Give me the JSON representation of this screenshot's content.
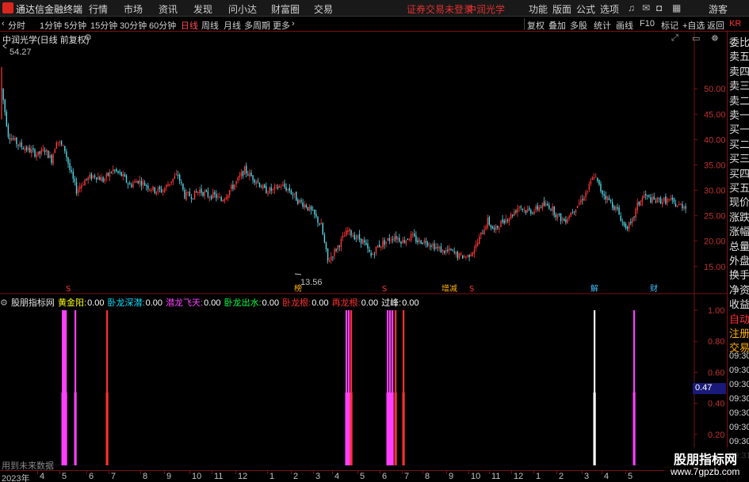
{
  "top_bar": {
    "app_name": "通达信金融终端",
    "menus": [
      "行情",
      "市场",
      "资讯",
      "发现",
      "问小达",
      "财富圈",
      "交易"
    ],
    "alert": "证券交易未登录",
    "alert_stock": "中润光学",
    "right_menus": [
      "功能",
      "版面",
      "公式",
      "选项"
    ],
    "user": "游客"
  },
  "toolbar": {
    "periods": [
      "分时",
      "1分钟",
      "5分钟",
      "15分钟",
      "30分钟",
      "60分钟",
      "日线",
      "周线",
      "月线",
      "多周期",
      "更多"
    ],
    "active_period": "日线",
    "tools": [
      "复权",
      "叠加",
      "多股",
      "统计",
      "画线",
      "F10",
      "标记",
      "+自选",
      "返回"
    ]
  },
  "main_chart": {
    "title": "中润光学(日线 前复权)",
    "high_label": "54.27",
    "low_label": "13.56",
    "y_ticks": [
      "50.00",
      "45.00",
      "40.00",
      "35.00",
      "30.00",
      "25.00",
      "20.00",
      "15.00"
    ],
    "event_markers": [
      {
        "text": "S",
        "color": "#ff3030"
      },
      {
        "text": "榜",
        "color": "#ffb000"
      },
      {
        "text": "S",
        "color": "#ff3030"
      },
      {
        "text": "增减",
        "color": "#ffb000"
      },
      {
        "text": "S",
        "color": "#ff3030"
      },
      {
        "text": "解",
        "color": "#40c0ff"
      },
      {
        "text": "财",
        "color": "#40c0ff"
      }
    ]
  },
  "chart_data": {
    "type": "candlestick",
    "title": "中润光学(日线 前复权)",
    "ylim": [
      12,
      60
    ],
    "high": 54.27,
    "low": 13.56,
    "trend": [
      [
        0,
        50
      ],
      [
        4,
        41
      ],
      [
        10,
        39
      ],
      [
        16,
        38
      ],
      [
        22,
        37
      ],
      [
        26,
        38
      ],
      [
        30,
        36
      ],
      [
        33,
        40
      ],
      [
        38,
        38
      ],
      [
        41,
        34
      ],
      [
        45,
        30
      ],
      [
        50,
        32
      ],
      [
        56,
        33
      ],
      [
        61,
        32
      ],
      [
        67,
        34
      ],
      [
        72,
        33
      ],
      [
        77,
        31
      ],
      [
        82,
        32
      ],
      [
        87,
        31
      ],
      [
        92,
        30
      ],
      [
        97,
        30
      ],
      [
        102,
        32
      ],
      [
        106,
        33
      ],
      [
        110,
        29
      ],
      [
        115,
        29
      ],
      [
        119,
        30
      ],
      [
        124,
        29
      ],
      [
        128,
        29
      ],
      [
        132,
        28
      ],
      [
        137,
        30
      ],
      [
        142,
        32
      ],
      [
        146,
        34
      ],
      [
        149,
        33
      ],
      [
        153,
        32
      ],
      [
        158,
        30
      ],
      [
        163,
        30
      ],
      [
        168,
        31
      ],
      [
        173,
        30
      ],
      [
        178,
        28
      ],
      [
        183,
        27
      ],
      [
        188,
        25
      ],
      [
        192,
        23
      ],
      [
        196,
        16
      ],
      [
        200,
        18
      ],
      [
        204,
        20
      ],
      [
        208,
        22
      ],
      [
        212,
        21
      ],
      [
        217,
        20
      ],
      [
        222,
        17
      ],
      [
        226,
        19
      ],
      [
        231,
        20
      ],
      [
        236,
        21
      ],
      [
        241,
        20
      ],
      [
        246,
        21
      ],
      [
        250,
        20
      ],
      [
        255,
        20
      ],
      [
        260,
        19
      ],
      [
        265,
        18
      ],
      [
        270,
        18
      ],
      [
        275,
        17
      ],
      [
        280,
        17
      ],
      [
        285,
        19
      ],
      [
        289,
        22
      ],
      [
        292,
        24
      ],
      [
        296,
        22
      ],
      [
        301,
        24
      ],
      [
        306,
        25
      ],
      [
        311,
        27
      ],
      [
        315,
        26
      ],
      [
        320,
        26
      ],
      [
        324,
        27
      ],
      [
        329,
        27
      ],
      [
        334,
        25
      ],
      [
        338,
        24
      ],
      [
        343,
        26
      ],
      [
        348,
        28
      ],
      [
        352,
        30
      ],
      [
        356,
        33
      ],
      [
        360,
        30
      ],
      [
        365,
        28
      ],
      [
        370,
        26
      ],
      [
        374,
        23
      ],
      [
        378,
        23
      ],
      [
        382,
        27
      ],
      [
        386,
        29
      ],
      [
        391,
        28
      ],
      [
        396,
        28
      ],
      [
        401,
        28
      ],
      [
        406,
        27
      ],
      [
        410,
        27
      ]
    ]
  },
  "indicator": {
    "name": "股朋指标网",
    "legend": [
      {
        "label": "黄金阳:",
        "value": "0.00",
        "color": "#ffff00"
      },
      {
        "label": "卧龙深潜:",
        "value": "0.00",
        "color": "#00e0ff"
      },
      {
        "label": "潜龙飞天:",
        "value": "0.00",
        "color": "#ff40ff"
      },
      {
        "label": "卧龙出水:",
        "value": "0.00",
        "color": "#00ff40"
      },
      {
        "label": "卧龙根:",
        "value": "0.00",
        "color": "#ff3030"
      },
      {
        "label": "再龙根:",
        "value": "0.00",
        "color": "#ff3030"
      },
      {
        "label": "过峰:",
        "value": "0.00",
        "color": "#ffffff"
      }
    ],
    "y_ticks": [
      "1.00",
      "0.80",
      "0.60",
      "0.40",
      "0.20"
    ],
    "current_value": "0.47",
    "signals": [
      {
        "x": 79,
        "color": "#ff40ff"
      },
      {
        "x": 81,
        "color": "#ff40ff"
      },
      {
        "x": 83,
        "color": "#ff40ff"
      },
      {
        "x": 95,
        "color": "#ff40ff"
      },
      {
        "x": 135,
        "color": "#ff3030"
      },
      {
        "x": 437,
        "color": "#ff40ff"
      },
      {
        "x": 440,
        "color": "#ff40ff"
      },
      {
        "x": 443,
        "color": "#ff3030"
      },
      {
        "x": 489,
        "color": "#ff40ff"
      },
      {
        "x": 492,
        "color": "#ff40ff"
      },
      {
        "x": 495,
        "color": "#ff40ff"
      },
      {
        "x": 499,
        "color": "#ff3030"
      },
      {
        "x": 509,
        "color": "#ff3030"
      },
      {
        "x": 750,
        "color": "#ffffff"
      },
      {
        "x": 800,
        "color": "#ff40ff"
      }
    ]
  },
  "bottom_note": "用到未来数据",
  "x_axis": {
    "year": "2023年",
    "months": [
      "4",
      "5",
      "6",
      "7",
      "8",
      "9",
      "10",
      "11",
      "12",
      "1",
      "2",
      "3",
      "4",
      "5",
      "6",
      "7",
      "8",
      "9",
      "10",
      "11",
      "12",
      "1",
      "2",
      "3",
      "4",
      "5"
    ]
  },
  "right_panel": {
    "partial_top": "KR",
    "quote_labels": [
      "委比",
      "卖五",
      "卖四",
      "卖三",
      "卖二",
      "卖一",
      "买一",
      "买二",
      "买三",
      "买四",
      "买五",
      "现价",
      "涨跌",
      "涨幅",
      "总量",
      "外盘",
      "换手",
      "净资",
      "收益",
      "自动",
      "注册",
      "交易"
    ],
    "times": [
      "09:30",
      "09:30",
      "09:30",
      "09:30",
      "09:30",
      "09:30",
      "09:30",
      "09:31"
    ]
  },
  "watermark": {
    "line1": "股朋指标网",
    "line2": "www.7gpzb.com"
  }
}
